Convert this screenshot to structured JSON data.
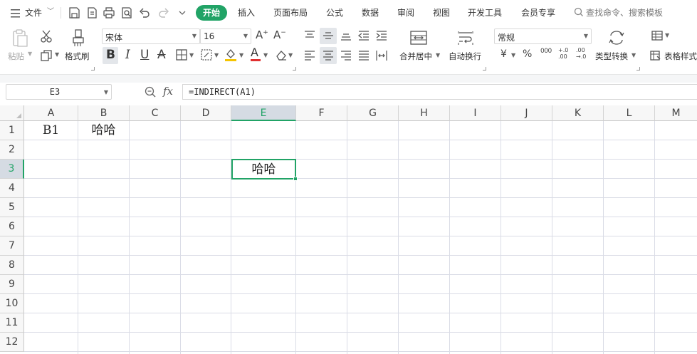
{
  "menubar": {
    "hamburger_label": "文件",
    "tabs": [
      "插入",
      "页面布局",
      "公式",
      "数据",
      "审阅",
      "视图",
      "开发工具",
      "会员专享"
    ],
    "active_tab": "开始",
    "search_placeholder": "查找命令、搜索模板"
  },
  "ribbon": {
    "paste_label": "粘贴",
    "format_painter_label": "格式刷",
    "font_name": "宋体",
    "font_size": "16",
    "merge_center_label": "合并居中",
    "wrap_text_label": "自动换行",
    "number_format": "常规",
    "type_convert_label": "类型转换",
    "table_style_label": "表格样式",
    "bold_glyph": "B",
    "italic_glyph": "I",
    "underline_glyph": "U",
    "strike_glyph": "A",
    "font_color_glyph": "A",
    "currency_glyph": "¥",
    "percent_glyph": "%",
    "thousands_glyph": "000",
    "inc_decimal_glyph": "+.0 .00",
    "dec_decimal_glyph": ".00 →.0",
    "grow_font_glyph": "A+",
    "shrink_font_glyph": "A-",
    "font_color_hex": "#e03030",
    "highlight_color_hex": "#f5c400"
  },
  "formula_bar": {
    "name_box": "E3",
    "fx_label": "fx",
    "formula": "=INDIRECT(A1)"
  },
  "sheet": {
    "columns": [
      "A",
      "B",
      "C",
      "D",
      "E",
      "F",
      "G",
      "H",
      "I",
      "J",
      "K",
      "L",
      "M"
    ],
    "rows": [
      "1",
      "2",
      "3",
      "4",
      "5",
      "6",
      "7",
      "8",
      "9",
      "10",
      "11",
      "12"
    ],
    "selected_column": "E",
    "selected_row": "3",
    "cells": {
      "A1": "B1",
      "B1": "哈哈",
      "E3": "哈哈"
    }
  },
  "colors": {
    "accent": "#21a366",
    "grid_line": "#dadce6",
    "header_bg": "#f7f7f7"
  }
}
